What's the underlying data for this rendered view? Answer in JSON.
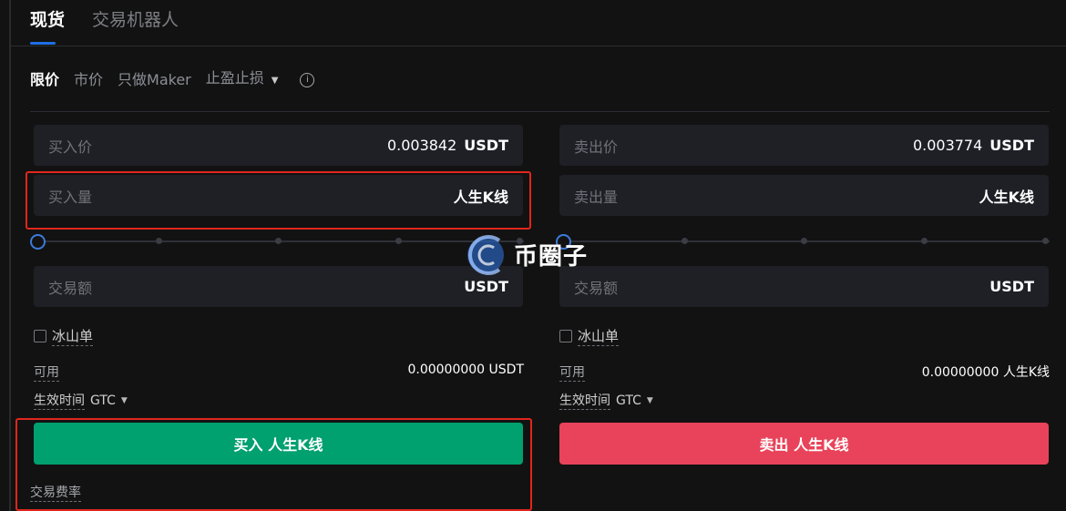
{
  "tabs": [
    {
      "label": "现货",
      "active": true
    },
    {
      "label": "交易机器人",
      "active": false
    }
  ],
  "order_types": {
    "limit": "限价",
    "market": "市价",
    "maker_only": "只做Maker",
    "tp_sl": "止盈止损"
  },
  "buy": {
    "price_label": "买入价",
    "price_value": "0.003842",
    "price_unit": "USDT",
    "amount_label": "买入量",
    "amount_unit": "人生K线",
    "total_label": "交易额",
    "total_unit": "USDT",
    "iceberg_label": "冰山单",
    "available_label": "可用",
    "available_value": "0.00000000 USDT",
    "tif_label": "生效时间",
    "tif_value": "GTC",
    "button_label": "买入 人生K线",
    "fee_label": "交易费率"
  },
  "sell": {
    "price_label": "卖出价",
    "price_value": "0.003774",
    "price_unit": "USDT",
    "amount_label": "卖出量",
    "amount_unit": "人生K线",
    "total_label": "交易额",
    "total_unit": "USDT",
    "iceberg_label": "冰山单",
    "available_label": "可用",
    "available_value": "0.00000000 人生K线",
    "tif_label": "生效时间",
    "tif_value": "GTC",
    "button_label": "卖出 人生K线"
  },
  "slider_value_percent": 0,
  "watermark": {
    "text": "币圈子"
  },
  "colors": {
    "buy": "#00a06f",
    "sell": "#e8435a",
    "accent": "#1f6fe5",
    "highlight": "#e0261c"
  }
}
